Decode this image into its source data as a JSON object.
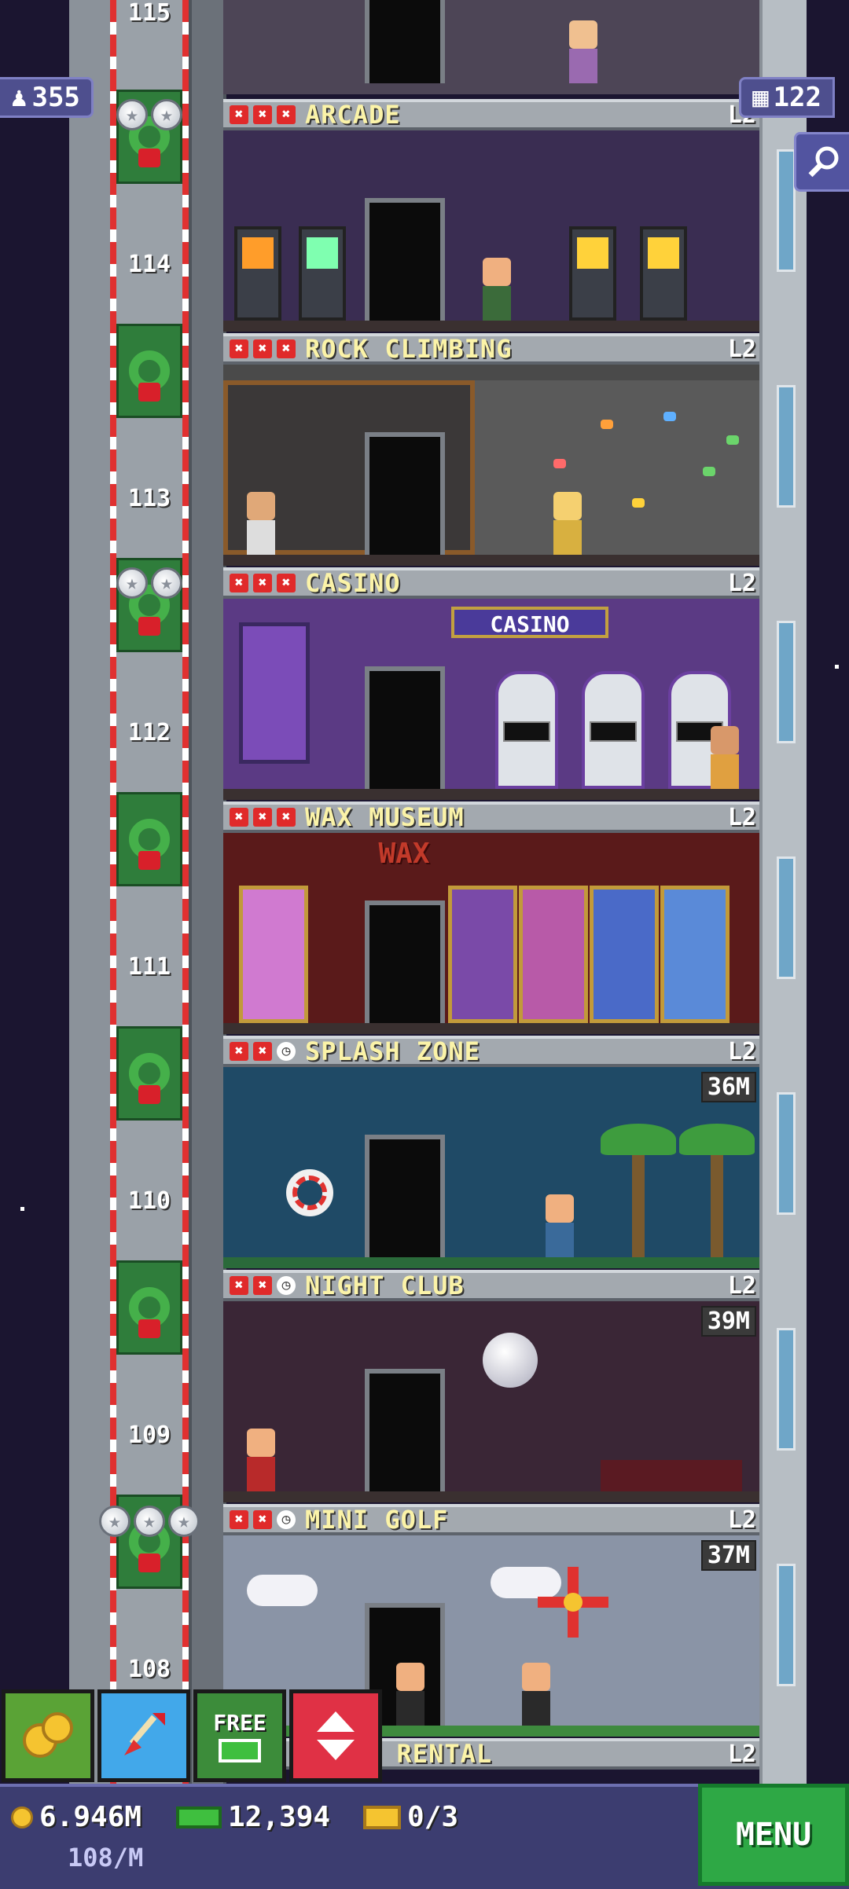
{
  "hud": {
    "population": "355",
    "floor_count": "122",
    "search_icon": "magnifier-icon"
  },
  "elevator": {
    "floor_numbers": [
      "115",
      "114",
      "113",
      "112",
      "111",
      "110",
      "109",
      "108"
    ]
  },
  "floors": [
    {
      "name": "ARCADE",
      "level": "L2",
      "timer": ""
    },
    {
      "name": "ROCK CLIMBING",
      "level": "L2",
      "timer": ""
    },
    {
      "name": "CASINO",
      "level": "L2",
      "timer": "",
      "sign": "CASINO"
    },
    {
      "name": "WAX MUSEUM",
      "level": "L2",
      "timer": "",
      "sign": "WAX"
    },
    {
      "name": "SPLASH ZONE",
      "level": "L2",
      "timer": "36M"
    },
    {
      "name": "NIGHT CLUB",
      "level": "L2",
      "timer": "39M"
    },
    {
      "name": "MINI GOLF",
      "level": "L2",
      "timer": "37M"
    },
    {
      "name": "D RENTAL",
      "level": "L2",
      "timer": ""
    }
  ],
  "toolbar": {
    "bux_icon": "bux-coins-icon",
    "dig_icon": "shovel-icon",
    "free_label": "FREE",
    "elevator_icon": "elevator-arrows-icon"
  },
  "currency": {
    "coins": "6.946M",
    "bux": "12,394",
    "tickets": "0/3",
    "rate": "108/M"
  },
  "menu": {
    "label": "MENU"
  },
  "colors": {
    "background": "#1b1530",
    "hud_blue": "#4e4f8e",
    "menu_green": "#2ea845",
    "floor_name_yellow": "#fbf3a8"
  }
}
